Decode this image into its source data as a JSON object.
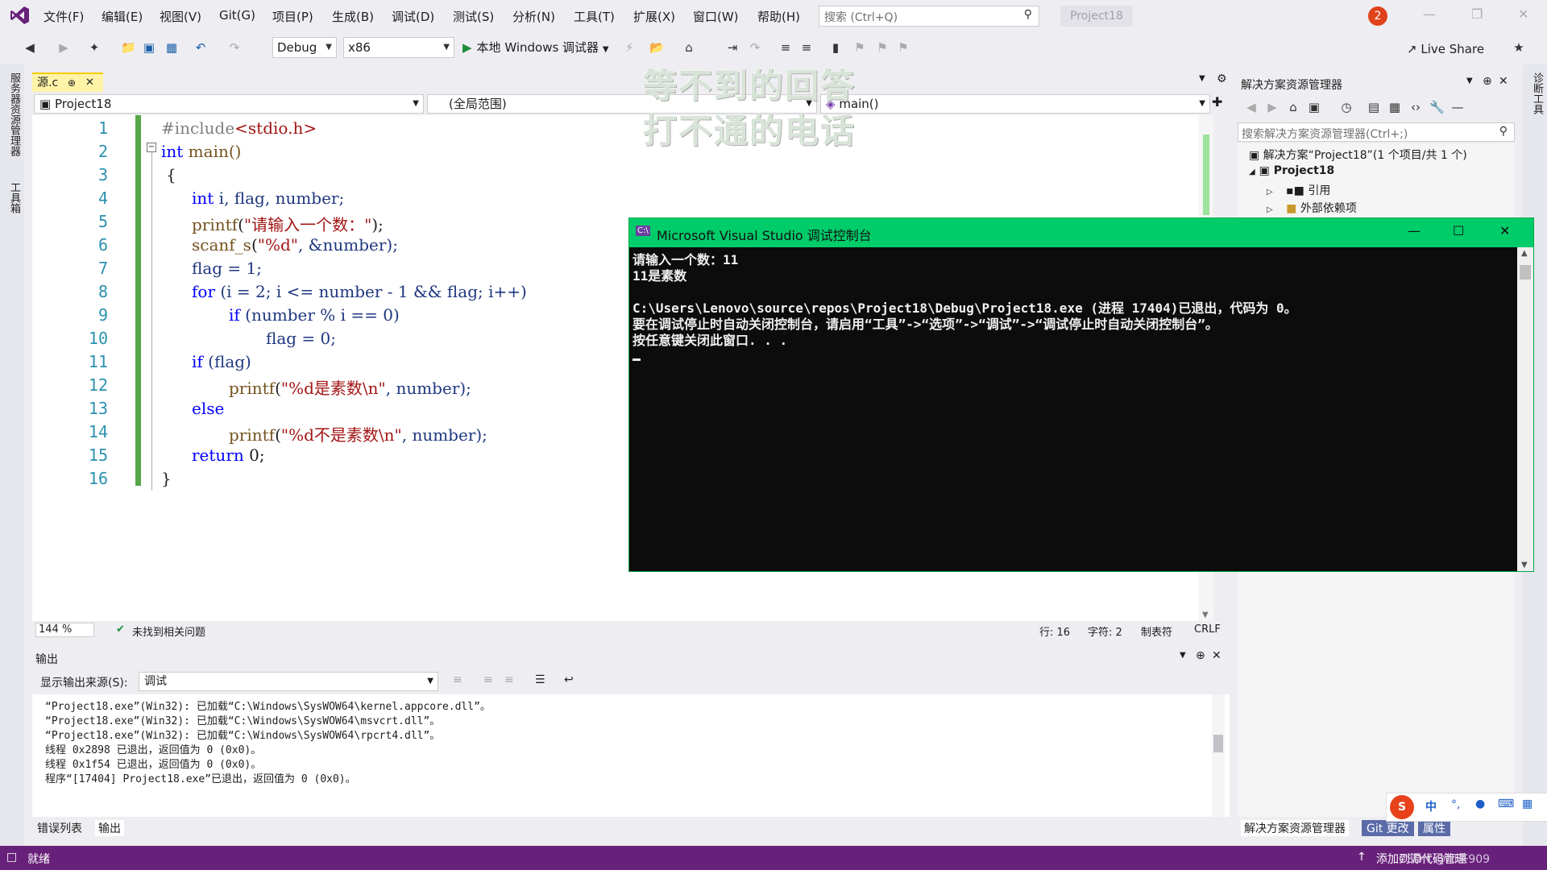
{
  "menu": [
    "文件(F)",
    "编辑(E)",
    "视图(V)",
    "Git(G)",
    "项目(P)",
    "生成(B)",
    "调试(D)",
    "测试(S)",
    "分析(N)",
    "工具(T)",
    "扩展(X)",
    "窗口(W)",
    "帮助(H)"
  ],
  "search": {
    "placeholder": "搜索 (Ctrl+Q)"
  },
  "project_title": "Project18",
  "notification_count": "2",
  "toolbar": {
    "config": "Debug",
    "platform": "x86",
    "run_label": "本地 Windows 调试器",
    "live_share": "Live Share"
  },
  "left_strip": [
    "服务器资源管理器",
    "工具箱"
  ],
  "right_strip": [
    "诊断工具"
  ],
  "editor": {
    "tab_name": "源.c",
    "nav_project": "Project18",
    "nav_scope": "(全局范围)",
    "nav_member": "main()",
    "line_numbers": [
      "1",
      "2",
      "3",
      "4",
      "5",
      "6",
      "7",
      "8",
      "9",
      "10",
      "11",
      "12",
      "13",
      "14",
      "15",
      "16"
    ],
    "code": {
      "l1_pp": "#include",
      "l1_hdr": "<stdio.h>",
      "l2_kw": "int",
      "l2_rest": " main()",
      "l3": "{",
      "l4_kw": "int",
      "l4_rest": " i, flag, number;",
      "l5_fn": "printf",
      "l5_open": "(",
      "l5_str": "\"请输入一个数：\"",
      "l5_close": ");",
      "l6_fn": "scanf_s",
      "l6_open": "(",
      "l6_str": "\"%d\"",
      "l6_rest": ", &number);",
      "l7": "flag = 1;",
      "l8_kw": "for",
      "l8_rest": " (i = 2; i <= number - 1 && flag; i++)",
      "l9_kw": "if",
      "l9_rest": " (number % i == 0)",
      "l10": "flag = 0;",
      "l11_kw": "if",
      "l11_rest": " (flag)",
      "l12_fn": "printf",
      "l12_open": "(",
      "l12_str": "\"%d是素数\\n\"",
      "l12_rest": ", number);",
      "l13_kw": "else",
      "l14_fn": "printf",
      "l14_open": "(",
      "l14_str": "\"%d不是素数\\n\"",
      "l14_rest": ", number);",
      "l15_kw": "return",
      "l15_rest": " 0;",
      "l16": "}"
    },
    "zoom": "144 %",
    "issues": "未找到相关问题",
    "position_line": "行: 16",
    "position_char": "字符: 2",
    "indent": "制表符",
    "line_ending": "CRLF"
  },
  "lyrics": [
    "等不到的回答",
    "打不通的电话"
  ],
  "output": {
    "title": "输出",
    "source_label": "显示输出来源(S):",
    "source_value": "调试",
    "lines": [
      "“Project18.exe”(Win32): 已加载“C:\\Windows\\SysWOW64\\kernel.appcore.dll”。",
      "“Project18.exe”(Win32): 已加载“C:\\Windows\\SysWOW64\\msvcrt.dll”。",
      "“Project18.exe”(Win32): 已加载“C:\\Windows\\SysWOW64\\rpcrt4.dll”。",
      "线程 0x2898 已退出，返回值为 0 (0x0)。",
      "线程 0x1f54 已退出，返回值为 0 (0x0)。",
      "程序“[17404] Project18.exe”已退出，返回值为 0 (0x0)。"
    ]
  },
  "bottom_tabs": [
    "错误列表",
    "输出"
  ],
  "solution_explorer": {
    "title": "解决方案资源管理器",
    "search_placeholder": "搜索解决方案资源管理器(Ctrl+;)",
    "solution": "解决方案“Project18”(1 个项目/共 1 个)",
    "project": "Project18",
    "references": "引用",
    "external_deps": "外部依赖项",
    "tabs": [
      "解决方案资源管理器",
      "Git 更改",
      "属性"
    ]
  },
  "console": {
    "title": "Microsoft Visual Studio 调试控制台",
    "lines": [
      "请输入一个数：11",
      "11是素数",
      "",
      "C:\\Users\\Lenovo\\source\\repos\\Project18\\Debug\\Project18.exe (进程 17404)已退出，代码为 0。",
      "要在调试停止时自动关闭控制台，请启用“工具”->“选项”->“调试”->“调试停止时自动关闭控制台”。",
      "按任意键关闭此窗口. . ."
    ]
  },
  "statusbar": {
    "ready": "就绪",
    "add_source": "添加到源代码管理",
    "watermark": "CSDN @加茶909"
  },
  "ime": {
    "lang": "中"
  },
  "colors": {
    "statusbar": "#68217a",
    "console_title": "#00cc6a",
    "keyword": "#0000ff",
    "string": "#a31515",
    "line_number": "#2b91af"
  }
}
